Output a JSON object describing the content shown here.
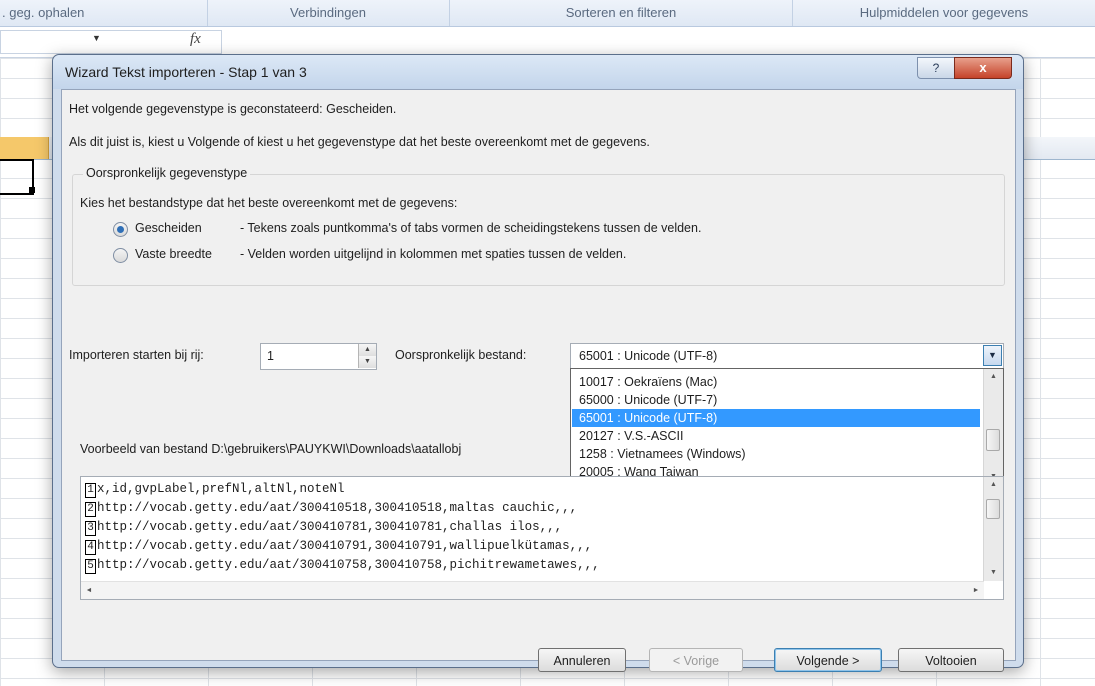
{
  "excel": {
    "ribbon_groups": [
      ". geg. ophalen",
      "Verbindingen",
      "Sorteren en filteren",
      "Hulpmiddelen voor gegevens"
    ],
    "fx_symbol": "fx"
  },
  "dialog": {
    "title": "Wizard Tekst importeren - Stap 1 van 3",
    "help_glyph": "?",
    "close_glyph": "x",
    "line1": "Het volgende gegevenstype is geconstateerd: Gescheiden.",
    "line2": "Als dit juist is, kiest u Volgende of kiest u het gegevenstype dat het beste overeenkomt met de gegevens.",
    "group": {
      "legend": "Oorspronkelijk gegevenstype",
      "intro": "Kies het bestandstype dat het beste overeenkomt met de gegevens:",
      "options": [
        {
          "label": "Gescheiden",
          "description": "- Tekens zoals puntkomma's of tabs vormen de scheidingstekens tussen de velden.",
          "checked": true
        },
        {
          "label": "Vaste breedte",
          "description": "- Velden worden uitgelijnd in kolommen met spaties tussen de velden.",
          "checked": false
        }
      ]
    },
    "start_row": {
      "label": "Importeren starten bij rij:",
      "value": "1"
    },
    "origin": {
      "label": "Oorspronkelijk bestand:",
      "value": "65001 : Unicode (UTF-8)",
      "options": [
        "10017 : Oekraïens (Mac)",
        "65000 : Unicode (UTF-7)",
        "65001 : Unicode (UTF-8)",
        "20127 : V.S.-ASCII",
        " 1258 : Vietnamees (Windows)",
        "20005 : Wang Taiwan"
      ],
      "selected_index": 2
    },
    "preview": {
      "label": "Voorbeeld van bestand D:\\gebruikers\\PAUYKWI\\Downloads\\aatallobj",
      "lines": [
        {
          "num": "1",
          "text": "x,id,gvpLabel,prefNl,altNl,noteNl"
        },
        {
          "num": "2",
          "text": "http://vocab.getty.edu/aat/300410518,300410518,maltas cauchic,,,"
        },
        {
          "num": "3",
          "text": "http://vocab.getty.edu/aat/300410781,300410781,challas ilos,,,"
        },
        {
          "num": "4",
          "text": "http://vocab.getty.edu/aat/300410791,300410791,wallipuelkütamas,,,"
        },
        {
          "num": "5",
          "text": "http://vocab.getty.edu/aat/300410758,300410758,pichitrewametawes,,,"
        }
      ]
    },
    "buttons": {
      "cancel": "Annuleren",
      "back": "< Vorige",
      "next": "Volgende >",
      "finish": "Voltooien"
    }
  }
}
